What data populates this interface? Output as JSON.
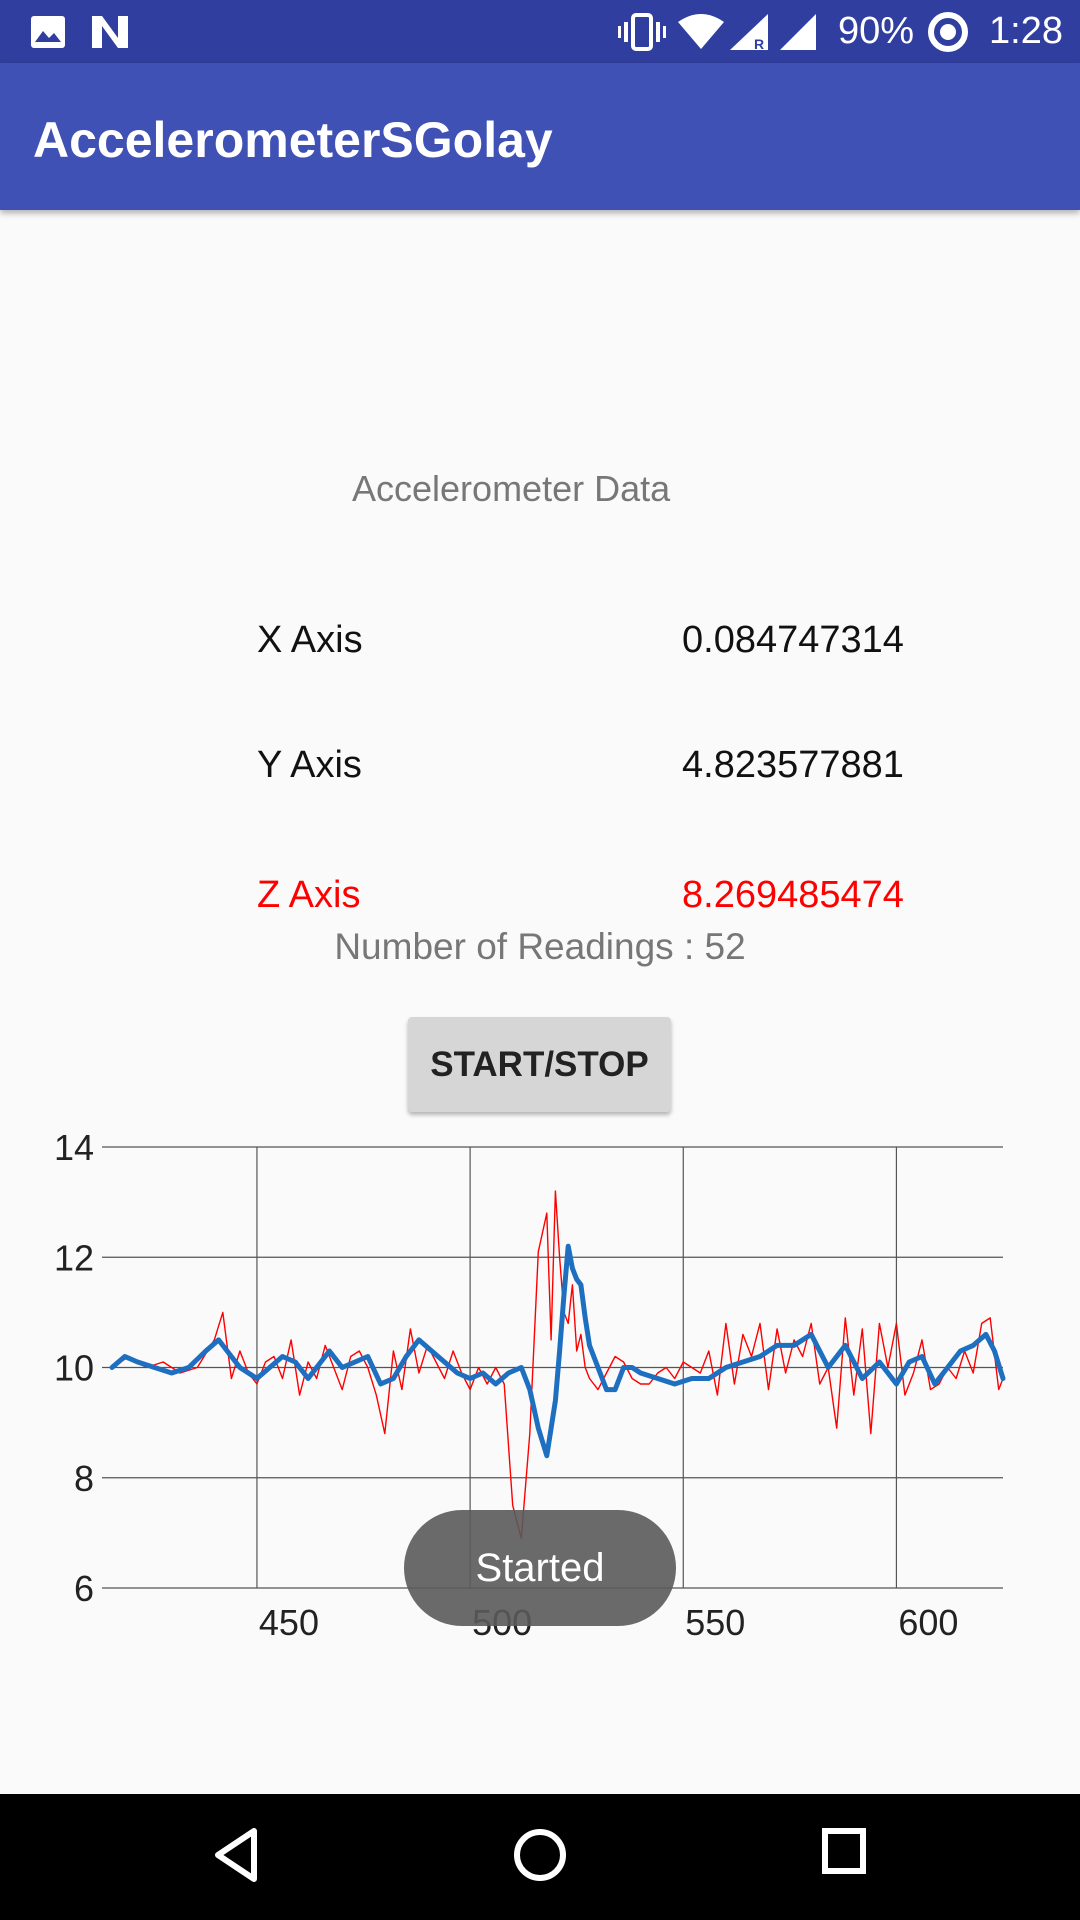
{
  "status_bar": {
    "battery": "90%",
    "time": "1:28",
    "icons": [
      "image-icon",
      "n-notification-icon",
      "vibrate-icon",
      "wifi-icon",
      "signal-roaming-icon",
      "signal-icon",
      "data-saver-icon"
    ]
  },
  "app_bar": {
    "title": "AccelerometerSGolay"
  },
  "content": {
    "heading": "Accelerometer Data",
    "rows": [
      {
        "label": "X Axis",
        "value": "0.084747314",
        "color": "#111111"
      },
      {
        "label": "Y Axis",
        "value": "4.823577881",
        "color": "#111111"
      },
      {
        "label": "Z Axis",
        "value": "8.269485474",
        "color": "#ff0000"
      }
    ],
    "readings": "Number of Readings : 52",
    "button": "START/STOP"
  },
  "chart_data": {
    "type": "line",
    "xlim": [
      416,
      625
    ],
    "ylim": [
      6,
      14
    ],
    "x_ticks": [
      450,
      500,
      550,
      600
    ],
    "y_ticks": [
      6,
      8,
      10,
      12,
      14
    ],
    "x_tick_labels": [
      "450",
      "500",
      "550",
      "600"
    ],
    "y_tick_labels": [
      "6",
      "8",
      "10",
      "12",
      "14"
    ],
    "grid": true,
    "series": [
      {
        "color": "#ff0000",
        "x": [
          416,
          420,
          424,
          428,
          432,
          436,
          440,
          442,
          444,
          446,
          448,
          450,
          452,
          454,
          456,
          458,
          460,
          462,
          464,
          466,
          468,
          470,
          472,
          474,
          476,
          478,
          480,
          482,
          484,
          486,
          488,
          490,
          492,
          494,
          496,
          498,
          500,
          502,
          504,
          506,
          508,
          510,
          512,
          514,
          516,
          518,
          519,
          520,
          521,
          522,
          523,
          524,
          525,
          526,
          527,
          528,
          530,
          532,
          534,
          536,
          538,
          540,
          542,
          544,
          546,
          548,
          550,
          552,
          554,
          556,
          558,
          560,
          562,
          564,
          566,
          568,
          570,
          572,
          574,
          576,
          578,
          580,
          582,
          584,
          586,
          588,
          590,
          592,
          594,
          596,
          598,
          600,
          602,
          604,
          606,
          608,
          610,
          612,
          614,
          616,
          618,
          620,
          622,
          624,
          625
        ],
        "y": [
          10.0,
          10.2,
          10.0,
          10.1,
          9.9,
          10.0,
          10.5,
          11.0,
          9.8,
          10.3,
          9.9,
          9.7,
          10.1,
          10.2,
          9.8,
          10.5,
          9.5,
          10.1,
          9.8,
          10.4,
          10.0,
          9.6,
          10.2,
          10.3,
          10.0,
          9.5,
          8.8,
          10.3,
          9.6,
          10.7,
          9.9,
          10.4,
          10.1,
          9.8,
          10.3,
          9.9,
          9.6,
          10.0,
          9.7,
          10.0,
          9.7,
          7.5,
          6.9,
          8.8,
          12.1,
          12.8,
          10.5,
          13.2,
          12.0,
          11.0,
          10.8,
          11.5,
          10.3,
          10.6,
          10.0,
          9.8,
          9.6,
          9.9,
          10.2,
          10.1,
          9.8,
          9.7,
          9.7,
          9.9,
          10.0,
          9.8,
          10.1,
          10.0,
          9.9,
          10.3,
          9.5,
          10.8,
          9.7,
          10.6,
          10.2,
          10.8,
          9.6,
          10.7,
          9.9,
          10.5,
          10.2,
          10.8,
          9.7,
          10.0,
          8.9,
          10.9,
          9.5,
          10.7,
          8.8,
          10.8,
          10.0,
          10.8,
          9.5,
          9.9,
          10.5,
          9.6,
          9.7,
          10.0,
          9.8,
          10.3,
          9.9,
          10.8,
          10.9,
          9.6,
          9.8
        ]
      },
      {
        "color": "#1f6fc0",
        "x": [
          416,
          419,
          422,
          426,
          430,
          434,
          438,
          441,
          444,
          446,
          448,
          450,
          453,
          456,
          459,
          462,
          464,
          467,
          470,
          473,
          476,
          479,
          482,
          485,
          488,
          491,
          494,
          497,
          500,
          503,
          506,
          509,
          512,
          514,
          516,
          518,
          520,
          521,
          522,
          523,
          524,
          525,
          526,
          527,
          528,
          530,
          532,
          534,
          536,
          538,
          540,
          544,
          548,
          552,
          556,
          560,
          564,
          568,
          572,
          576,
          580,
          584,
          588,
          592,
          596,
          600,
          603,
          606,
          609,
          612,
          615,
          618,
          621,
          623,
          625
        ],
        "y": [
          10.0,
          10.2,
          10.1,
          10.0,
          9.9,
          10.0,
          10.3,
          10.5,
          10.2,
          10.0,
          9.9,
          9.8,
          10.0,
          10.2,
          10.1,
          9.8,
          10.0,
          10.3,
          10.0,
          10.1,
          10.2,
          9.7,
          9.8,
          10.2,
          10.5,
          10.3,
          10.1,
          9.9,
          9.8,
          9.9,
          9.7,
          9.9,
          10.0,
          9.6,
          8.9,
          8.4,
          9.4,
          10.3,
          11.3,
          12.2,
          11.8,
          11.6,
          11.5,
          10.9,
          10.4,
          10.0,
          9.6,
          9.6,
          10.0,
          10.0,
          9.9,
          9.8,
          9.7,
          9.8,
          9.8,
          10.0,
          10.1,
          10.2,
          10.4,
          10.4,
          10.6,
          10.0,
          10.4,
          9.8,
          10.1,
          9.7,
          10.1,
          10.2,
          9.7,
          10.0,
          10.3,
          10.4,
          10.6,
          10.3,
          9.8
        ]
      }
    ]
  },
  "toast": {
    "text": "Started"
  },
  "nav_bar": {
    "icons": [
      "back-icon",
      "home-icon",
      "recents-icon"
    ]
  }
}
